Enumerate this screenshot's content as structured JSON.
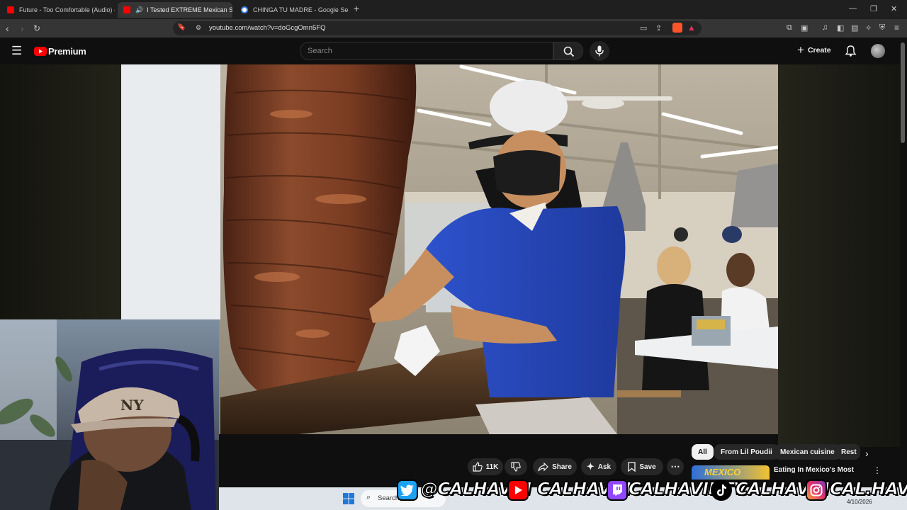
{
  "browser": {
    "tabs": [
      {
        "title": "Future - Too Comfortable (Audio) - Y",
        "favicon": "youtube-favicon"
      },
      {
        "title": "I Tested EXTREME Mexican St",
        "favicon": "youtube-favicon",
        "active": true
      },
      {
        "title": "CHINGA TU MADRE - Google Search",
        "favicon": "google-favicon"
      }
    ],
    "new_tab": "+",
    "url": "youtube.com/watch?v=doGcgOmn5FQ",
    "window_controls": [
      "—",
      "❐",
      "✕"
    ]
  },
  "youtube": {
    "logo_text": "Premium",
    "search_placeholder": "Search",
    "create_label": "Create"
  },
  "actions": {
    "like_count": "11K",
    "share": "Share",
    "ask": "Ask",
    "save": "Save",
    "more": "⋯"
  },
  "chips": [
    "All",
    "From Lil Poudii",
    "Mexican cuisine",
    "Rest"
  ],
  "recommendation": {
    "title": "Eating In Mexico's Most",
    "thumb_text": "MEXICO"
  },
  "taskbar": {
    "search_label": "Search",
    "date": "4/10/2026"
  },
  "stream_banner": {
    "twitter": "@CALHAVIN",
    "youtube": "CALHAVIN",
    "twitch": "CALHAVINTV",
    "tiktok": "CALHAVIN",
    "instagram": "CAL.HAVIN"
  },
  "colors": {
    "youtube_red": "#ff0000",
    "twitch_purple": "#9146ff",
    "twitter_blue": "#1da1f2",
    "shirt_blue": "#2c4fc4"
  }
}
